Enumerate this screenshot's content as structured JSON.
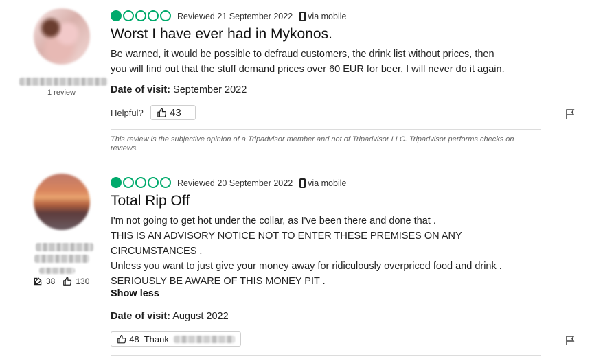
{
  "reviews": [
    {
      "rating": 1,
      "reviewed": "Reviewed 21 September 2022",
      "via": "via mobile",
      "title": "Worst I have ever had in Mykonos.",
      "body": [
        "Be warned, it would be possible to defraud customers, the drink list without prices, then",
        "you will find out that the stuff demand prices over 60 EUR for beer, I will never do it again."
      ],
      "review_count": "1 review",
      "visit_label": "Date of visit:",
      "visit_date": "September 2022",
      "helpful_label": "Helpful?",
      "helpful_count": "43",
      "disclaimer": "This review is the subjective opinion of a Tripadvisor member and not of Tripadvisor LLC. Tripadvisor performs checks on reviews."
    },
    {
      "rating": 1,
      "reviewed": "Reviewed 20 September 2022",
      "via": "via mobile",
      "title": "Total Rip Off",
      "body": [
        "I'm not going to get hot under the collar, as I've been there and done that .",
        "THIS IS AN ADVISORY NOTICE NOT TO ENTER THESE PREMISES ON ANY",
        "CIRCUMSTANCES .",
        "Unless you want to just give your money away for ridiculously overpriced food and drink .",
        "SERIOUSLY BE AWARE OF THIS MONEY PIT ."
      ],
      "contributions": "38",
      "helpful_votes": "130",
      "show_less": "Show less",
      "visit_label": "Date of visit:",
      "visit_date": "August 2022",
      "helpful_count": "48",
      "thank_label": "Thank"
    }
  ],
  "colors": {
    "bubble": "#00aa6c"
  },
  "icons": [
    "rating-bubble-icon",
    "mobile-phone-icon",
    "thumbs-up-icon",
    "edit-icon",
    "flag-icon"
  ]
}
